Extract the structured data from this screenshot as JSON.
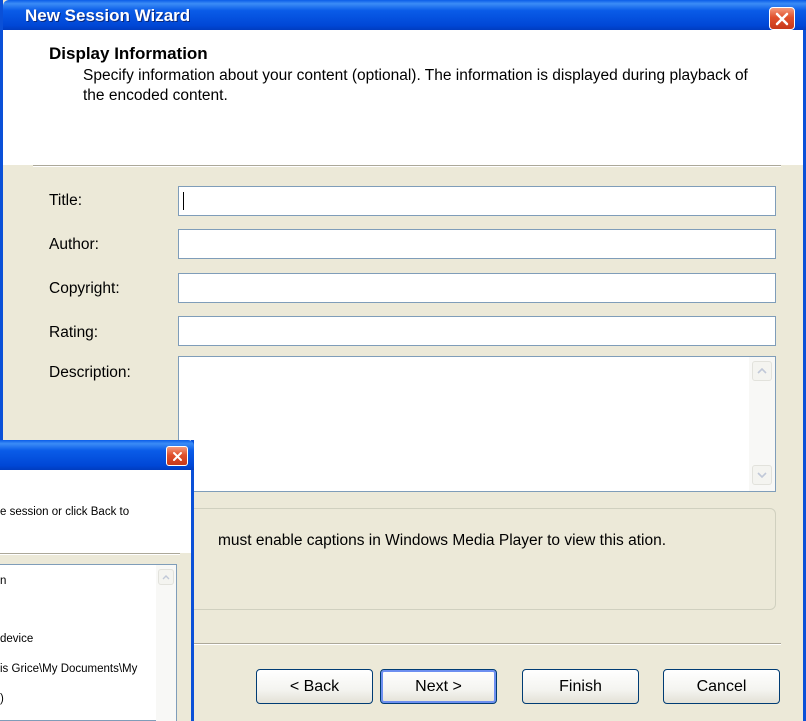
{
  "window": {
    "title": "New Session Wizard"
  },
  "header": {
    "title": "Display Information",
    "description": "Specify information about your content (optional). The information is displayed during playback of the encoded content."
  },
  "fields": {
    "title_label": "Title:",
    "title_value": "",
    "author_label": "Author:",
    "author_value": "",
    "copyright_label": "Copyright:",
    "copyright_value": "",
    "rating_label": "Rating:",
    "rating_value": "",
    "description_label": "Description:",
    "description_value": ""
  },
  "caption_note": "must enable captions in Windows Media Player to view this ation.",
  "buttons": {
    "back": "< Back",
    "next": "Next >",
    "finish": "Finish",
    "cancel": "Cancel"
  },
  "background_window": {
    "header_text": "e session or click Back to",
    "list_items": [
      "n",
      "device",
      "is Grice\\My Documents\\My",
      ")"
    ]
  },
  "colors": {
    "title_bar": "#0a5ce8",
    "window_bg": "#ece9d8",
    "close_button": "#e0502c"
  }
}
